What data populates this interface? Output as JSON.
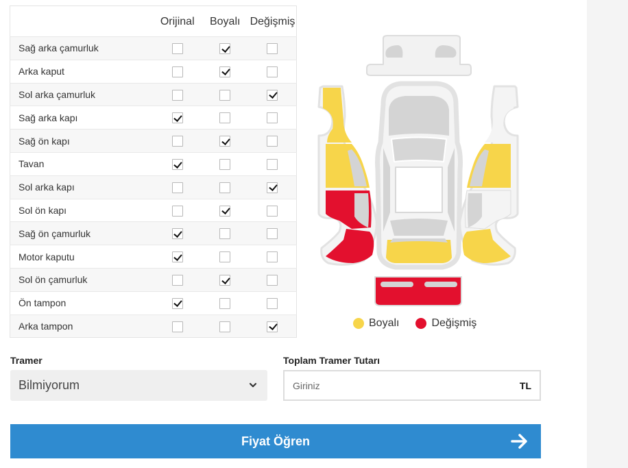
{
  "table": {
    "headers": {
      "part": "",
      "original": "Orijinal",
      "painted": "Boyalı",
      "replaced": "Değişmiş"
    },
    "rows": [
      {
        "part": "Sağ arka çamurluk",
        "status": "painted"
      },
      {
        "part": "Arka kaput",
        "status": "painted"
      },
      {
        "part": "Sol arka çamurluk",
        "status": "replaced"
      },
      {
        "part": "Sağ arka kapı",
        "status": "original"
      },
      {
        "part": "Sağ ön kapı",
        "status": "painted"
      },
      {
        "part": "Tavan",
        "status": "original"
      },
      {
        "part": "Sol arka kapı",
        "status": "replaced"
      },
      {
        "part": "Sol ön kapı",
        "status": "painted"
      },
      {
        "part": "Sağ ön çamurluk",
        "status": "original"
      },
      {
        "part": "Motor kaputu",
        "status": "original"
      },
      {
        "part": "Sol ön çamurluk",
        "status": "painted"
      },
      {
        "part": "Ön tampon",
        "status": "original"
      },
      {
        "part": "Arka tampon",
        "status": "replaced"
      }
    ]
  },
  "diagram": {
    "colors": {
      "painted": "#f7d54a",
      "replaced": "#e3102e",
      "original": "#d6d6d6",
      "outline": "#e6e6e6",
      "window": "#d4d4d4"
    }
  },
  "legend": {
    "painted": {
      "label": "Boyalı",
      "color": "#f7d54a"
    },
    "replaced": {
      "label": "Değişmiş",
      "color": "#e3102e"
    }
  },
  "tramer": {
    "label": "Tramer",
    "selected": "Bilmiyorum",
    "icon": "chevron-down-icon"
  },
  "amount": {
    "label": "Toplam Tramer Tutarı",
    "placeholder": "Giriniz",
    "value": "",
    "unit": "TL"
  },
  "submit": {
    "label": "Fiyat Öğren",
    "icon": "arrow-right-icon",
    "color": "#2f8bd0"
  }
}
